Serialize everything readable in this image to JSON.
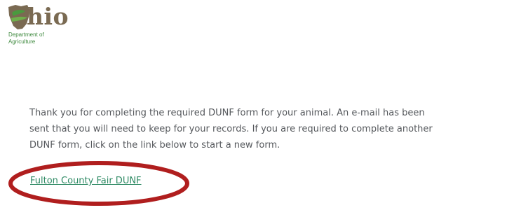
{
  "logo": {
    "wordmark": "hio",
    "subtitle_line1": "Department of",
    "subtitle_line2": "Agriculture"
  },
  "message": {
    "line1": "Thank you for completing the required DUNF form for your animal.  An e-mail has been",
    "line2": "sent that you will need to keep for your records.  If you are required to complete another",
    "line3": "DUNF form, click on the link below to start a new form."
  },
  "link": {
    "label": "Fulton County Fair DUNF"
  },
  "colors": {
    "logo_brown": "#7a6a52",
    "logo_green": "#3f8a3f",
    "body_text": "#55585c",
    "link": "#2e8a64",
    "highlight": "#b01e1e"
  }
}
